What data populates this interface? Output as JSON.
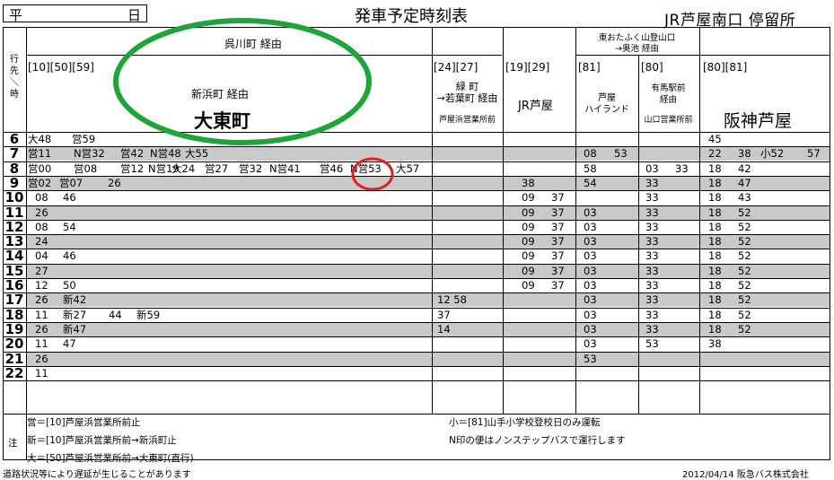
{
  "header": {
    "day_left": "平",
    "day_right": "日",
    "title": "発車予定時刻表",
    "stop": "JR芦屋南口  停留所"
  },
  "columns": {
    "row_header": [
      "行",
      "先",
      "＼",
      "時"
    ],
    "c1": {
      "top_via": "呉川町 経由",
      "routes": "[10][50][59]",
      "via": "新浜町 経由",
      "dest": "大東町"
    },
    "c2": {
      "routes": "[24][27]",
      "via_l1": "緑  町",
      "via_l2": "→若葉町 経由",
      "sub": "芦屋浜営業所前"
    },
    "c3": {
      "routes": "[19][29]",
      "dest": "JR芦屋"
    },
    "c45": {
      "top_l1": "東おたふく山登山口",
      "top_l2": "→奥池 経由"
    },
    "c4": {
      "routes": "[81]",
      "dest_l1": "芦屋",
      "dest_l2": "ハイランド"
    },
    "c5": {
      "routes": "[80]",
      "via_l1": "有馬駅前",
      "via_l2": "経由",
      "sub": "山口営業所前"
    },
    "c6": {
      "routes": "[80][81]",
      "dest": "阪神芦屋"
    }
  },
  "hours": [
    "6",
    "7",
    "8",
    "9",
    "10",
    "11",
    "12",
    "13",
    "14",
    "15",
    "16",
    "17",
    "18",
    "19",
    "20",
    "21",
    "22"
  ],
  "rows": [
    {
      "c1": [
        "大48",
        "営59"
      ],
      "c2": "",
      "c3": [
        "",
        ""
      ],
      "c4": [
        "",
        ""
      ],
      "c5": [
        "",
        ""
      ],
      "c6": [
        "45",
        "",
        "",
        ""
      ]
    },
    {
      "c1": [
        "営11",
        "N営32",
        "営42",
        "N営48",
        "大55"
      ],
      "c2": "",
      "c3": [
        "",
        ""
      ],
      "c4": [
        "08",
        "53"
      ],
      "c5": [
        "",
        ""
      ],
      "c6": [
        "22",
        "38",
        "小52",
        "57"
      ]
    },
    {
      "c1": [
        "営00",
        "営08",
        "営12",
        "N営19",
        "大24",
        "営27",
        "営32",
        "N営41",
        "営46",
        "N営53",
        "大57"
      ],
      "c2": "",
      "c3": [
        "",
        ""
      ],
      "c4": [
        "58",
        ""
      ],
      "c5": [
        "03",
        "33"
      ],
      "c6": [
        "18",
        "42",
        "",
        ""
      ]
    },
    {
      "c1": [
        "営02",
        "営07",
        "26"
      ],
      "c2": "",
      "c3": [
        "38",
        ""
      ],
      "c4": [
        "54",
        ""
      ],
      "c5": [
        "33",
        ""
      ],
      "c6": [
        "18",
        "47",
        "",
        ""
      ]
    },
    {
      "c1": [
        "08",
        "46"
      ],
      "c2": "",
      "c3": [
        "09",
        "37"
      ],
      "c4": [
        "",
        ""
      ],
      "c5": [
        "33",
        ""
      ],
      "c6": [
        "18",
        "43",
        "",
        ""
      ]
    },
    {
      "c1": [
        "26"
      ],
      "c2": "",
      "c3": [
        "09",
        "37"
      ],
      "c4": [
        "03",
        ""
      ],
      "c5": [
        "33",
        ""
      ],
      "c6": [
        "18",
        "52",
        "",
        ""
      ]
    },
    {
      "c1": [
        "08",
        "54"
      ],
      "c2": "",
      "c3": [
        "09",
        "37"
      ],
      "c4": [
        "03",
        ""
      ],
      "c5": [
        "33",
        ""
      ],
      "c6": [
        "18",
        "52",
        "",
        ""
      ]
    },
    {
      "c1": [
        "24"
      ],
      "c2": "",
      "c3": [
        "09",
        "37"
      ],
      "c4": [
        "03",
        ""
      ],
      "c5": [
        "33",
        ""
      ],
      "c6": [
        "18",
        "52",
        "",
        ""
      ]
    },
    {
      "c1": [
        "04",
        "46"
      ],
      "c2": "",
      "c3": [
        "09",
        "37"
      ],
      "c4": [
        "03",
        ""
      ],
      "c5": [
        "33",
        ""
      ],
      "c6": [
        "18",
        "52",
        "",
        ""
      ]
    },
    {
      "c1": [
        "27"
      ],
      "c2": "",
      "c3": [
        "09",
        "37"
      ],
      "c4": [
        "03",
        ""
      ],
      "c5": [
        "33",
        ""
      ],
      "c6": [
        "18",
        "52",
        "",
        ""
      ]
    },
    {
      "c1": [
        "12",
        "50"
      ],
      "c2": "",
      "c3": [
        "09",
        "37"
      ],
      "c4": [
        "03",
        ""
      ],
      "c5": [
        "33",
        ""
      ],
      "c6": [
        "18",
        "52",
        "",
        ""
      ]
    },
    {
      "c1": [
        "26",
        "新42"
      ],
      "c2": "12   58",
      "c3": [
        "",
        ""
      ],
      "c4": [
        "03",
        ""
      ],
      "c5": [
        "33",
        ""
      ],
      "c6": [
        "18",
        "52",
        "",
        ""
      ]
    },
    {
      "c1": [
        "11",
        "新27",
        "44",
        "新59"
      ],
      "c2": "37",
      "c3": [
        "",
        ""
      ],
      "c4": [
        "03",
        ""
      ],
      "c5": [
        "33",
        ""
      ],
      "c6": [
        "18",
        "52",
        "",
        ""
      ]
    },
    {
      "c1": [
        "26",
        "新47"
      ],
      "c2": "14",
      "c3": [
        "",
        ""
      ],
      "c4": [
        "03",
        ""
      ],
      "c5": [
        "33",
        ""
      ],
      "c6": [
        "18",
        "52",
        "",
        ""
      ]
    },
    {
      "c1": [
        "11",
        "47"
      ],
      "c2": "",
      "c3": [
        "",
        ""
      ],
      "c4": [
        "03",
        ""
      ],
      "c5": [
        "53",
        ""
      ],
      "c6": [
        "38",
        "",
        "",
        ""
      ]
    },
    {
      "c1": [
        "26"
      ],
      "c2": "",
      "c3": [
        "",
        ""
      ],
      "c4": [
        "53",
        ""
      ],
      "c5": [
        "",
        ""
      ],
      "c6": [
        "",
        "",
        "",
        ""
      ]
    },
    {
      "c1": [
        "11"
      ],
      "c2": "",
      "c3": [
        "",
        ""
      ],
      "c4": [
        "",
        ""
      ],
      "c5": [
        "",
        ""
      ],
      "c6": [
        "",
        "",
        "",
        ""
      ]
    }
  ],
  "notes": {
    "label": "注",
    "left": [
      "営＝[10]芦屋浜営業所前止",
      "新＝[10]芦屋浜営業所前→新浜町止",
      "大＝[50]芦屋浜営業所前→大東町(直行)"
    ],
    "right": [
      "小＝[81]山手小学校登校日のみ運転",
      "N印の便はノンステップバスで運行します"
    ]
  },
  "footer": {
    "left": "道路状況等により遅延が生じることがあります",
    "right": "2012/04/14  阪急バス株式会社"
  },
  "annotations": {
    "ellipse_color": "#1ea53a",
    "circle_color": "#e02020"
  }
}
